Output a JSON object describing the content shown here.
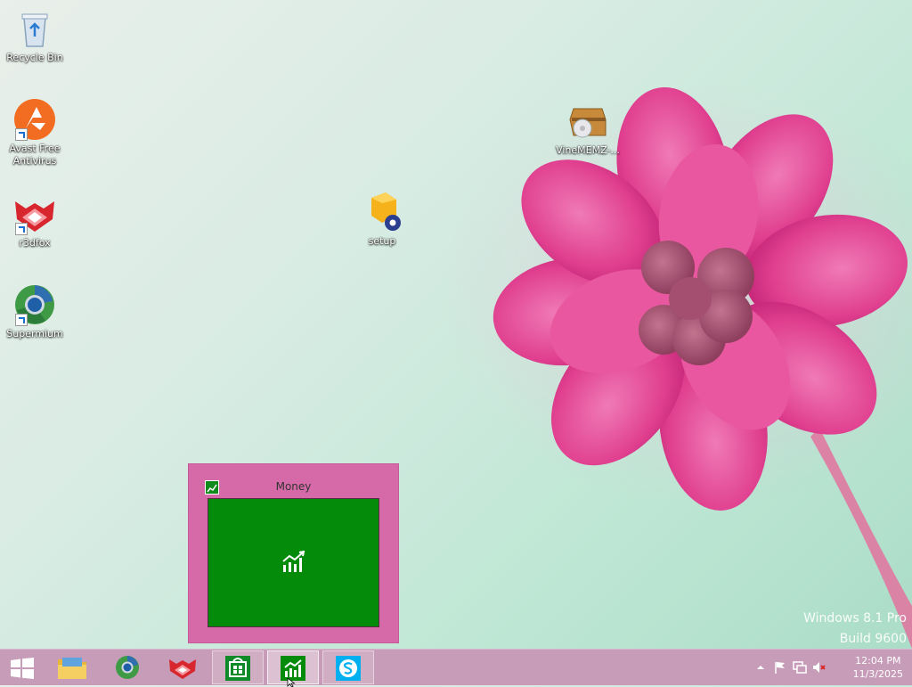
{
  "desktop": {
    "icons": [
      {
        "label": "Recycle Bin"
      },
      {
        "label": "Avast Free Antivirus"
      },
      {
        "label": "r3dfox"
      },
      {
        "label": "Supermium"
      },
      {
        "label": "setup"
      },
      {
        "label": "VineMEMZ-..."
      }
    ],
    "watermark": {
      "line1": "Windows 8.1 Pro",
      "line2": "Build 9600"
    }
  },
  "thumbnail": {
    "title": "Money"
  },
  "taskbar": {
    "start_icon": "windows-start-icon",
    "pinned": [
      "file-explorer-icon",
      "supermium-icon",
      "r3dfox-icon",
      "store-icon",
      "money-icon",
      "skype-icon"
    ]
  },
  "tray": {
    "time": "12:04 PM",
    "date": "11/3/2025"
  },
  "colors": {
    "taskbar": "#c79cb8",
    "thumbnail": "#d66aa8",
    "money_green": "#058b0a",
    "skype_blue": "#00aff0"
  }
}
